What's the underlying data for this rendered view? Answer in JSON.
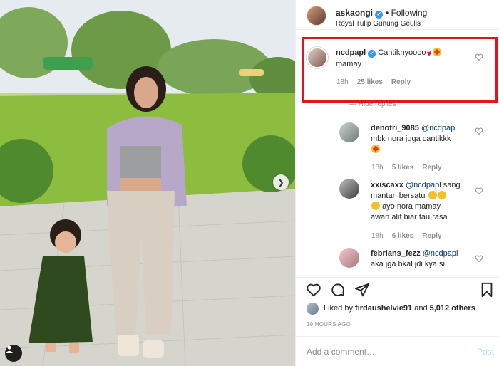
{
  "header": {
    "username": "askaongi",
    "follow_label": "• Following",
    "location": "Royal Tulip Gunung Geulis"
  },
  "comments": [
    {
      "username": "ncdpapl",
      "text": "Cantiknyoooo",
      "text_line2": "mamay",
      "time": "18h",
      "likes": "25 likes",
      "reply": "Reply"
    },
    {
      "username": "denotri_9085",
      "mention": "@ncdpapl",
      "text": "mbk nora juga cantikkk",
      "time": "18h",
      "likes": "5 likes",
      "reply": "Reply"
    },
    {
      "username": "xxiscaxx",
      "mention": "@ncdpapl",
      "text1": "sang",
      "text2": "mantan bersatu",
      "text3": "ayo nora mamay",
      "text4": "awan alif biar tau rasa",
      "time": "18h",
      "likes": "6 likes",
      "reply": "Reply"
    },
    {
      "username": "febrians_fezz",
      "mention": "@ncdpapl",
      "text": "aka jga bkal jdi kya si"
    }
  ],
  "hide_replies": "— Hide replies",
  "likes_line": {
    "prefix": "Liked by",
    "user": "firdaushelvie91",
    "suffix": "and",
    "others": "5,012 others"
  },
  "timestamp": "19 HOURS AGO",
  "add_comment": {
    "placeholder": "Add a comment…",
    "post_label": "Post"
  },
  "colors": {
    "highlight_border": "#e3141d",
    "verified": "#3897f0",
    "post_disabled": "#b2dffc"
  },
  "icons": [
    "heart-icon",
    "comment-icon",
    "share-icon",
    "bookmark-icon",
    "next-arrow-icon",
    "user-tag-icon"
  ]
}
